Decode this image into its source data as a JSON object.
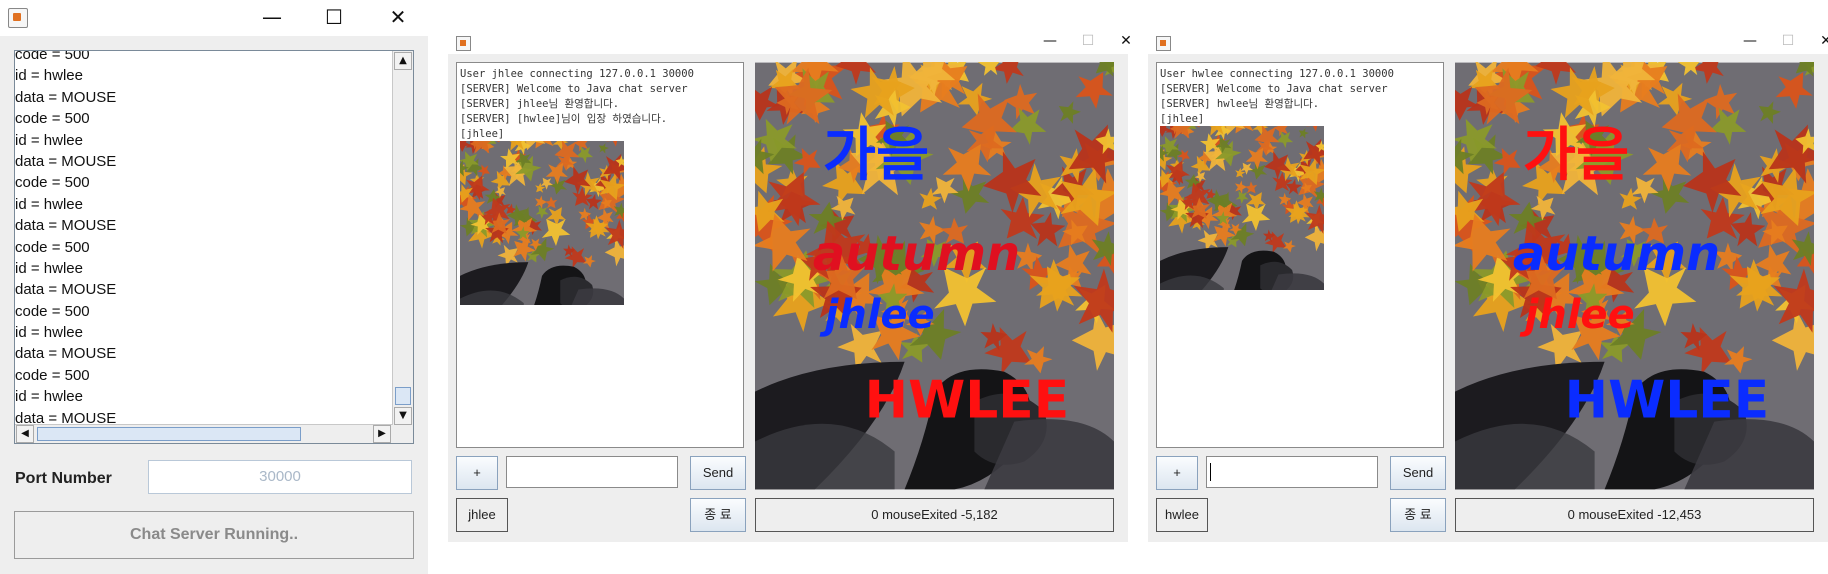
{
  "server": {
    "log_lines": [
      "code = 500",
      "id = hwlee",
      "data = MOUSE",
      "code = 500",
      "id = hwlee",
      "data = MOUSE",
      "code = 500",
      "id = hwlee",
      "data = MOUSE",
      "code = 500",
      "id = hwlee",
      "data = MOUSE",
      "code = 500",
      "id = hwlee",
      "data = MOUSE",
      "code = 500",
      "id = hwlee",
      "data = MOUSE"
    ],
    "port_label": "Port Number",
    "port_value": "30000",
    "status_button": "Chat Server Running..",
    "window_controls": {
      "minimize": "—",
      "maximize": "☐",
      "close": "✕"
    }
  },
  "client1": {
    "chat_lines": [
      "User jhlee connecting 127.0.0.1 30000",
      "[SERVER] Welcome to Java chat server",
      "[SERVER] jhlee님 환영합니다.",
      "[SERVER] [hwlee]님이 입장 하였습니다.",
      "[jhlee]"
    ],
    "plus_label": "+",
    "send_label": "Send",
    "exit_label": "종 료",
    "username": "jhlee",
    "status": "0 mouseExited -5,182",
    "drawings": [
      "가을",
      "autumn",
      "jhlee",
      "HWLEE"
    ],
    "colors": {
      "blue": "#0a2cff",
      "red": "#ff1010"
    }
  },
  "client2": {
    "chat_lines": [
      "User hwlee connecting 127.0.0.1 30000",
      "[SERVER] Welcome to Java chat server",
      "[SERVER] hwlee님 환영합니다.",
      "[jhlee]"
    ],
    "plus_label": "+",
    "send_label": "Send",
    "exit_label": "종 료",
    "username": "hwlee",
    "status": "0 mouseExited -12,453",
    "drawings": [
      "가을",
      "autumn",
      "jhlee",
      "HWLEE"
    ]
  }
}
